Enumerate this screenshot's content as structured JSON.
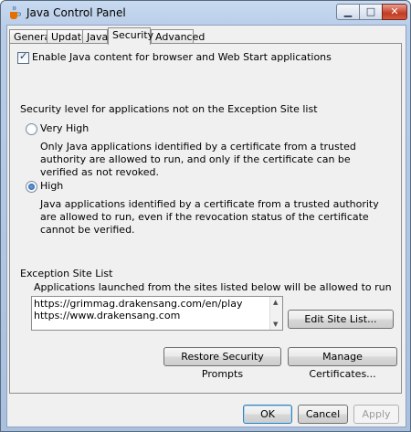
{
  "window": {
    "title": "Java Control Panel",
    "controls": {
      "minimize": "▁",
      "maximize": "□",
      "close": "✕"
    }
  },
  "tabs": [
    {
      "label": "General"
    },
    {
      "label": "Update"
    },
    {
      "label": "Java"
    },
    {
      "label": "Security",
      "active": true
    },
    {
      "label": "Advanced"
    }
  ],
  "security": {
    "enable_java_label": "Enable Java content for browser and Web Start applications",
    "enable_java_checked": true,
    "level_heading": "Security level for applications not on the Exception Site list",
    "levels": [
      {
        "label": "Very High",
        "selected": false,
        "description": "Only Java applications identified by a certificate from a trusted authority are allowed to run, and only if the certificate can be verified as not revoked."
      },
      {
        "label": "High",
        "selected": true,
        "description": "Java applications identified by a certificate from a trusted authority are allowed to run, even if the revocation status of the certificate cannot be verified."
      }
    ],
    "exception_heading": "Exception Site List",
    "exception_description": "Applications launched from the sites listed below will be allowed to run after the appropriate security prompts.",
    "sites": [
      "https://grimmag.drakensang.com/en/play",
      "https://www.drakensang.com"
    ],
    "edit_site_list_label": "Edit Site List...",
    "restore_prompts_label": "Restore Security Prompts",
    "manage_certs_label": "Manage Certificates..."
  },
  "footer": {
    "ok_label": "OK",
    "cancel_label": "Cancel",
    "apply_label": "Apply"
  }
}
